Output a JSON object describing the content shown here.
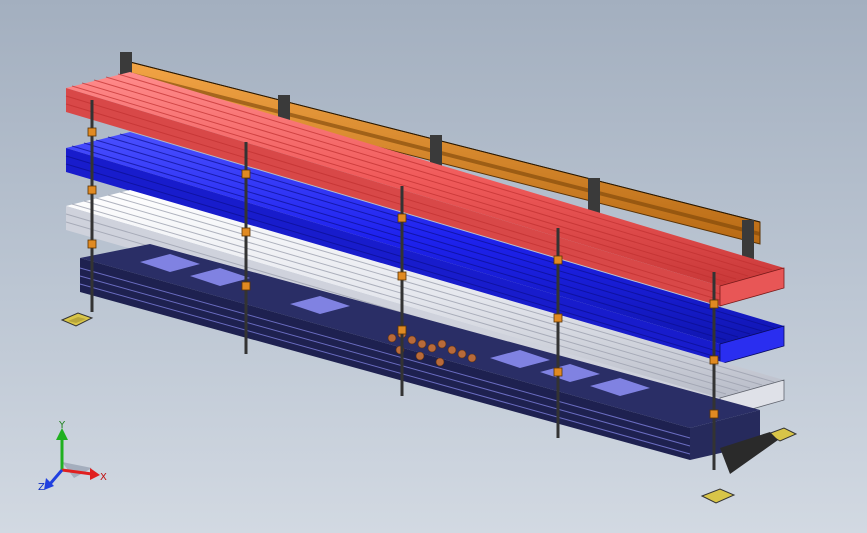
{
  "viewport": {
    "background_top": "#a3afbf",
    "background_bottom": "#d2d9e2"
  },
  "model": {
    "rack_frame_color": "#e08a22",
    "rack_frame_dark": "#8a4e0c",
    "shelf_colors": {
      "top_tier_pipes": "#f05a5a",
      "middle_tier_pipes": "#1e22ee",
      "lower_tier_pipes": "#e6e8ee",
      "base_bins": "#2a2e66",
      "base_bin_interior": "#8a8cf0",
      "copper_fittings": "#b86a3a"
    },
    "floor_marker_color": "#d8c548"
  },
  "triad": {
    "x_label": "X",
    "y_label": "Y",
    "z_label": "Z",
    "x_color": "#e02020",
    "y_color": "#20b020",
    "z_color": "#2040e0"
  }
}
